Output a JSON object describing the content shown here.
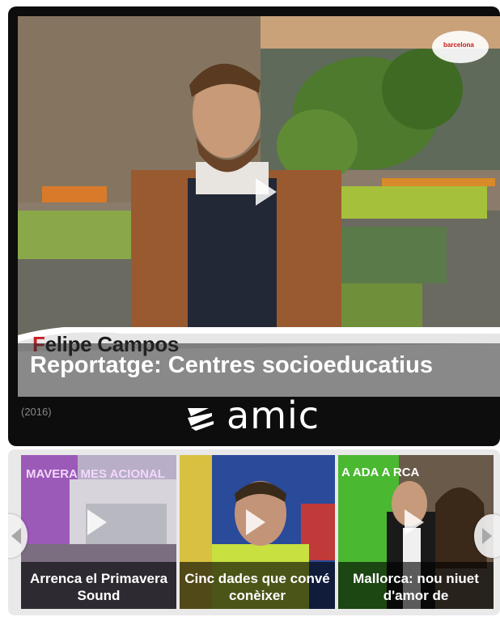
{
  "main_video": {
    "title": "Reportatge: Centres socioeducatius",
    "presenter_first_initial": "F",
    "presenter_rest": "elipe Campos",
    "year": "(2016)",
    "brand": "amic",
    "channel_logo": "barcelona"
  },
  "thumbnails": [
    {
      "caption": "Arrenca el Primavera Sound",
      "scene_text": "MAVERA MES ACIONAL"
    },
    {
      "caption": "Cinc dades que convé conèixer"
    },
    {
      "caption": "Mallorca: nou niuet d'amor de",
      "scene_text": "A ADA A RCA"
    }
  ],
  "icons": {
    "play": "play-icon",
    "prev": "chevron-left-icon",
    "next": "chevron-right-icon",
    "brand": "amic-logo-icon"
  },
  "colors": {
    "player_bg": "#0d0d0d",
    "title_overlay": "rgba(40,40,40,0.55)",
    "presenter_accent": "#c8202a",
    "carousel_bg": "#e9e9e9"
  }
}
